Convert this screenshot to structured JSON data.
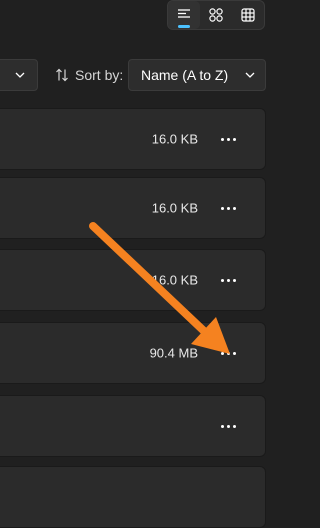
{
  "toolbar": {
    "view_buttons": [
      {
        "icon": "details-view-icon",
        "active": true
      },
      {
        "icon": "tiles-view-icon",
        "active": false
      },
      {
        "icon": "grid-view-icon",
        "active": false
      }
    ],
    "sort": {
      "label": "Sort by:",
      "value": "Name (A to Z)",
      "icon": "sort-arrows-icon"
    }
  },
  "files": [
    {
      "size": "16.0 KB"
    },
    {
      "size": "16.0 KB"
    },
    {
      "size": "16.0 KB"
    },
    {
      "size": "90.4 MB"
    },
    {
      "size": ""
    }
  ],
  "colors": {
    "background": "#202020",
    "row_background": "#2b2b2b",
    "accent": "#4cc2ff",
    "annotation_arrow": "#f58220"
  }
}
